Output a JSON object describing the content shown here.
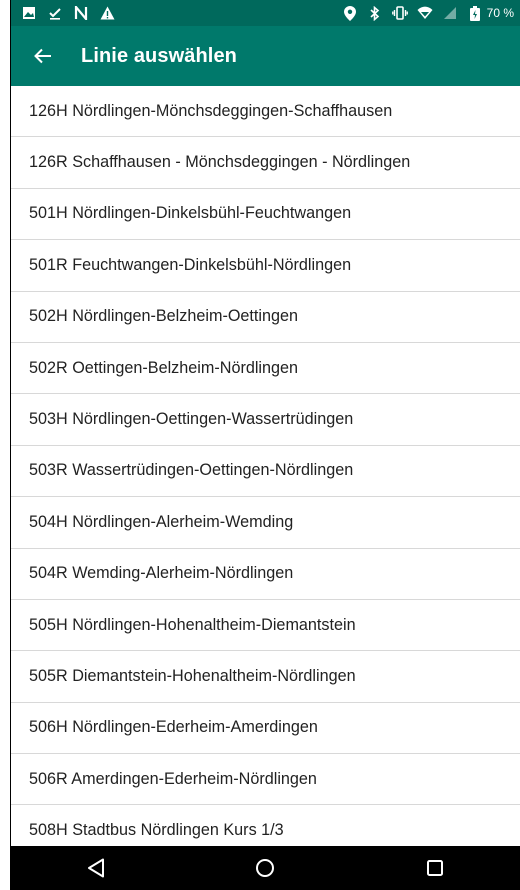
{
  "appbar": {
    "title": "Linie auswählen"
  },
  "statusbar": {
    "battery_percent": "70 %"
  },
  "lines": [
    "126H Nördlingen-Mönchsdeggingen-Schaffhausen",
    "126R Schaffhausen - Mönchsdeggingen - Nördlingen",
    "501H Nördlingen-Dinkelsbühl-Feuchtwangen",
    "501R Feuchtwangen-Dinkelsbühl-Nördlingen",
    "502H Nördlingen-Belzheim-Oettingen",
    "502R Oettingen-Belzheim-Nördlingen",
    "503H Nördlingen-Oettingen-Wassertrüdingen",
    "503R Wassertrüdingen-Oettingen-Nördlingen",
    "504H Nördlingen-Alerheim-Wemding",
    "504R Wemding-Alerheim-Nördlingen",
    "505H Nördlingen-Hohenaltheim-Diemantstein",
    "505R Diemantstein-Hohenaltheim-Nördlingen",
    "506H Nördlingen-Ederheim-Amerdingen",
    "506R Amerdingen-Ederheim-Nördlingen",
    "508H Stadtbus Nördlingen Kurs 1/3"
  ],
  "colors": {
    "statusbar": "#00695c",
    "appbar": "#00796b",
    "navbar": "#000000"
  }
}
